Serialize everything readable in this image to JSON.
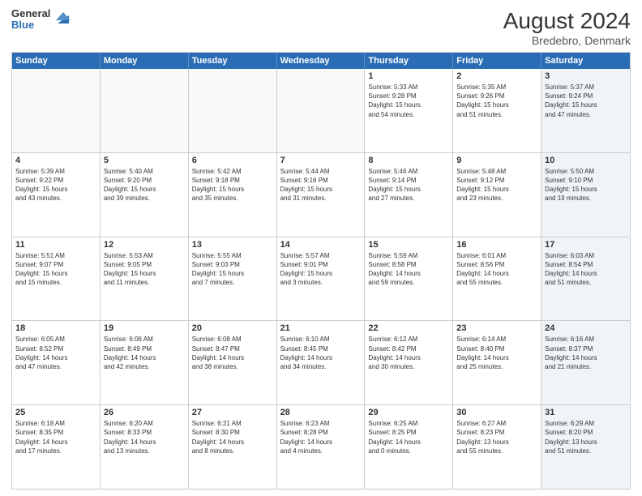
{
  "header": {
    "logo_general": "General",
    "logo_blue": "Blue",
    "month_year": "August 2024",
    "location": "Bredebro, Denmark"
  },
  "days": [
    "Sunday",
    "Monday",
    "Tuesday",
    "Wednesday",
    "Thursday",
    "Friday",
    "Saturday"
  ],
  "weeks": [
    [
      {
        "day": "",
        "info": "",
        "shaded": false,
        "empty": true
      },
      {
        "day": "",
        "info": "",
        "shaded": false,
        "empty": true
      },
      {
        "day": "",
        "info": "",
        "shaded": false,
        "empty": true
      },
      {
        "day": "",
        "info": "",
        "shaded": false,
        "empty": true
      },
      {
        "day": "1",
        "info": "Sunrise: 5:33 AM\nSunset: 9:28 PM\nDaylight: 15 hours\nand 54 minutes.",
        "shaded": false,
        "empty": false
      },
      {
        "day": "2",
        "info": "Sunrise: 5:35 AM\nSunset: 9:26 PM\nDaylight: 15 hours\nand 51 minutes.",
        "shaded": false,
        "empty": false
      },
      {
        "day": "3",
        "info": "Sunrise: 5:37 AM\nSunset: 9:24 PM\nDaylight: 15 hours\nand 47 minutes.",
        "shaded": true,
        "empty": false
      }
    ],
    [
      {
        "day": "4",
        "info": "Sunrise: 5:39 AM\nSunset: 9:22 PM\nDaylight: 15 hours\nand 43 minutes.",
        "shaded": false,
        "empty": false
      },
      {
        "day": "5",
        "info": "Sunrise: 5:40 AM\nSunset: 9:20 PM\nDaylight: 15 hours\nand 39 minutes.",
        "shaded": false,
        "empty": false
      },
      {
        "day": "6",
        "info": "Sunrise: 5:42 AM\nSunset: 9:18 PM\nDaylight: 15 hours\nand 35 minutes.",
        "shaded": false,
        "empty": false
      },
      {
        "day": "7",
        "info": "Sunrise: 5:44 AM\nSunset: 9:16 PM\nDaylight: 15 hours\nand 31 minutes.",
        "shaded": false,
        "empty": false
      },
      {
        "day": "8",
        "info": "Sunrise: 5:46 AM\nSunset: 9:14 PM\nDaylight: 15 hours\nand 27 minutes.",
        "shaded": false,
        "empty": false
      },
      {
        "day": "9",
        "info": "Sunrise: 5:48 AM\nSunset: 9:12 PM\nDaylight: 15 hours\nand 23 minutes.",
        "shaded": false,
        "empty": false
      },
      {
        "day": "10",
        "info": "Sunrise: 5:50 AM\nSunset: 9:10 PM\nDaylight: 15 hours\nand 19 minutes.",
        "shaded": true,
        "empty": false
      }
    ],
    [
      {
        "day": "11",
        "info": "Sunrise: 5:51 AM\nSunset: 9:07 PM\nDaylight: 15 hours\nand 15 minutes.",
        "shaded": false,
        "empty": false
      },
      {
        "day": "12",
        "info": "Sunrise: 5:53 AM\nSunset: 9:05 PM\nDaylight: 15 hours\nand 11 minutes.",
        "shaded": false,
        "empty": false
      },
      {
        "day": "13",
        "info": "Sunrise: 5:55 AM\nSunset: 9:03 PM\nDaylight: 15 hours\nand 7 minutes.",
        "shaded": false,
        "empty": false
      },
      {
        "day": "14",
        "info": "Sunrise: 5:57 AM\nSunset: 9:01 PM\nDaylight: 15 hours\nand 3 minutes.",
        "shaded": false,
        "empty": false
      },
      {
        "day": "15",
        "info": "Sunrise: 5:59 AM\nSunset: 8:58 PM\nDaylight: 14 hours\nand 59 minutes.",
        "shaded": false,
        "empty": false
      },
      {
        "day": "16",
        "info": "Sunrise: 6:01 AM\nSunset: 8:56 PM\nDaylight: 14 hours\nand 55 minutes.",
        "shaded": false,
        "empty": false
      },
      {
        "day": "17",
        "info": "Sunrise: 6:03 AM\nSunset: 8:54 PM\nDaylight: 14 hours\nand 51 minutes.",
        "shaded": true,
        "empty": false
      }
    ],
    [
      {
        "day": "18",
        "info": "Sunrise: 6:05 AM\nSunset: 8:52 PM\nDaylight: 14 hours\nand 47 minutes.",
        "shaded": false,
        "empty": false
      },
      {
        "day": "19",
        "info": "Sunrise: 6:06 AM\nSunset: 8:49 PM\nDaylight: 14 hours\nand 42 minutes.",
        "shaded": false,
        "empty": false
      },
      {
        "day": "20",
        "info": "Sunrise: 6:08 AM\nSunset: 8:47 PM\nDaylight: 14 hours\nand 38 minutes.",
        "shaded": false,
        "empty": false
      },
      {
        "day": "21",
        "info": "Sunrise: 6:10 AM\nSunset: 8:45 PM\nDaylight: 14 hours\nand 34 minutes.",
        "shaded": false,
        "empty": false
      },
      {
        "day": "22",
        "info": "Sunrise: 6:12 AM\nSunset: 8:42 PM\nDaylight: 14 hours\nand 30 minutes.",
        "shaded": false,
        "empty": false
      },
      {
        "day": "23",
        "info": "Sunrise: 6:14 AM\nSunset: 8:40 PM\nDaylight: 14 hours\nand 25 minutes.",
        "shaded": false,
        "empty": false
      },
      {
        "day": "24",
        "info": "Sunrise: 6:16 AM\nSunset: 8:37 PM\nDaylight: 14 hours\nand 21 minutes.",
        "shaded": true,
        "empty": false
      }
    ],
    [
      {
        "day": "25",
        "info": "Sunrise: 6:18 AM\nSunset: 8:35 PM\nDaylight: 14 hours\nand 17 minutes.",
        "shaded": false,
        "empty": false
      },
      {
        "day": "26",
        "info": "Sunrise: 6:20 AM\nSunset: 8:33 PM\nDaylight: 14 hours\nand 13 minutes.",
        "shaded": false,
        "empty": false
      },
      {
        "day": "27",
        "info": "Sunrise: 6:21 AM\nSunset: 8:30 PM\nDaylight: 14 hours\nand 8 minutes.",
        "shaded": false,
        "empty": false
      },
      {
        "day": "28",
        "info": "Sunrise: 6:23 AM\nSunset: 8:28 PM\nDaylight: 14 hours\nand 4 minutes.",
        "shaded": false,
        "empty": false
      },
      {
        "day": "29",
        "info": "Sunrise: 6:25 AM\nSunset: 8:25 PM\nDaylight: 14 hours\nand 0 minutes.",
        "shaded": false,
        "empty": false
      },
      {
        "day": "30",
        "info": "Sunrise: 6:27 AM\nSunset: 8:23 PM\nDaylight: 13 hours\nand 55 minutes.",
        "shaded": false,
        "empty": false
      },
      {
        "day": "31",
        "info": "Sunrise: 6:29 AM\nSunset: 8:20 PM\nDaylight: 13 hours\nand 51 minutes.",
        "shaded": true,
        "empty": false
      }
    ]
  ]
}
